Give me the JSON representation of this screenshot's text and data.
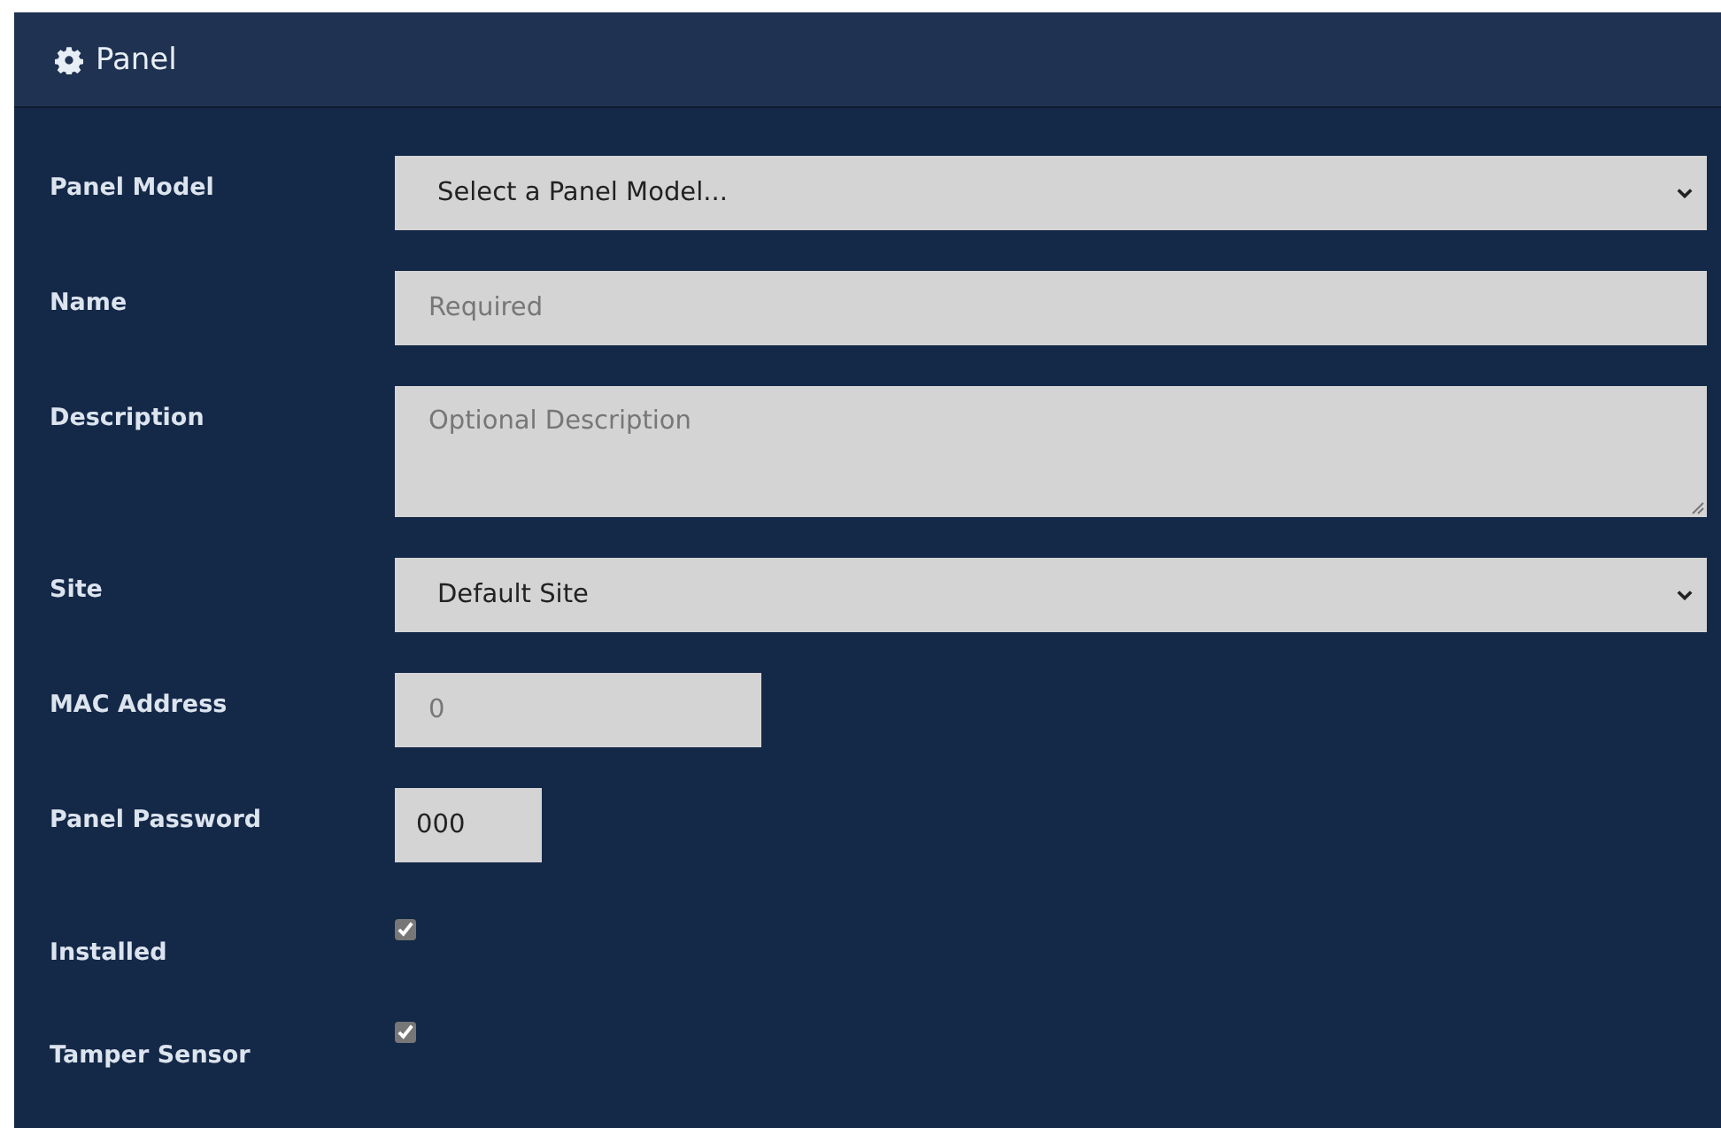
{
  "panel": {
    "title": "Panel"
  },
  "fields": [
    {
      "label": "Panel Model",
      "kind": "select",
      "value": "Select a Panel Model..."
    },
    {
      "label": "Name",
      "kind": "text",
      "placeholder": "Required"
    },
    {
      "label": "Description",
      "kind": "textarea",
      "placeholder": "Optional Description"
    },
    {
      "label": "Site",
      "kind": "select",
      "value": "Default Site"
    },
    {
      "label": "MAC Address",
      "kind": "medium",
      "placeholder": "0"
    },
    {
      "label": "Panel Password",
      "kind": "short",
      "value": "000"
    },
    {
      "label": "Installed",
      "kind": "checkbox",
      "checked": true
    },
    {
      "label": "Tamper Sensor",
      "kind": "checkbox",
      "checked": true
    }
  ]
}
